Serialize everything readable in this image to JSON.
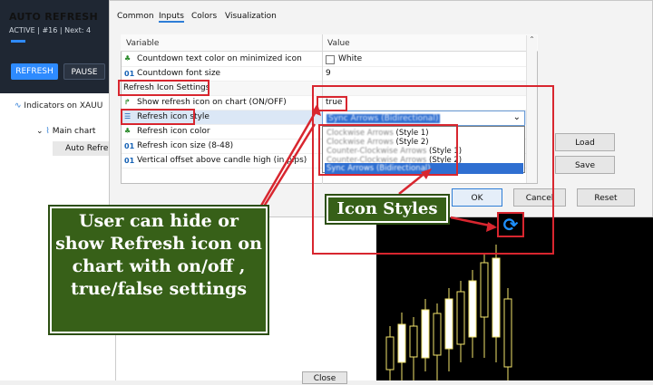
{
  "auto_panel": {
    "title": "AUTO REFRESH",
    "status": "ACTIVE  |  #16  |  Next: 4",
    "refresh_label": "REFRESH",
    "pause_label": "PAUSE"
  },
  "navigator": {
    "header": "Indicators on XAUU",
    "main_chart": "Main chart",
    "sub_item": "Auto Refre"
  },
  "dialog": {
    "tabs": [
      "Common",
      "Inputs",
      "Colors",
      "Visualization"
    ],
    "active_tab": "Inputs",
    "col_variable": "Variable",
    "col_value": "Value",
    "rows": [
      {
        "variable": "Countdown text color on minimized icon",
        "value": "White",
        "icon": "color-icon"
      },
      {
        "variable": "Countdown font size",
        "value": "9",
        "icon": "01-icon"
      },
      {
        "variable": "Refresh Icon Settings",
        "value": "",
        "icon": ""
      },
      {
        "variable": "Show refresh icon on chart (ON/OFF)",
        "value": "true",
        "icon": "bool-icon"
      },
      {
        "variable": "Refresh icon style",
        "value": "Sync Arrows (Bidirectional)",
        "icon": "list-icon"
      },
      {
        "variable": "Refresh icon color",
        "value": "",
        "icon": "color-icon"
      },
      {
        "variable": "Refresh icon size (8-48)",
        "value": "",
        "icon": "01-icon"
      },
      {
        "variable": "Vertical offset above candle high (in pips)",
        "value": "",
        "icon": "01-icon"
      }
    ],
    "dropdown_options": [
      {
        "name": "Clockwise Arrows",
        "tag": "(Style 1)"
      },
      {
        "name": "Clockwise Arrows",
        "tag": "(Style 2)"
      },
      {
        "name": "Counter-Clockwise Arrows",
        "tag": "(Style 1)"
      },
      {
        "name": "Counter-Clockwise Arrows",
        "tag": "(Style 2)"
      },
      {
        "name": "Sync Arrows (Bidirectional)",
        "tag": ""
      }
    ],
    "load_label": "Load",
    "save_label": "Save",
    "ok_label": "OK",
    "cancel_label": "Cancel",
    "reset_label": "Reset"
  },
  "annotations": {
    "left_callout": "User can hide or show Refresh icon on chart with on/off , true/false settings",
    "icon_styles": "Icon Styles"
  },
  "close_label": "Close",
  "colors": {
    "accent": "#2e8bff",
    "annotation_red": "#d8262f",
    "callout_green": "#376018",
    "selected_blue": "#2f6fd1"
  }
}
